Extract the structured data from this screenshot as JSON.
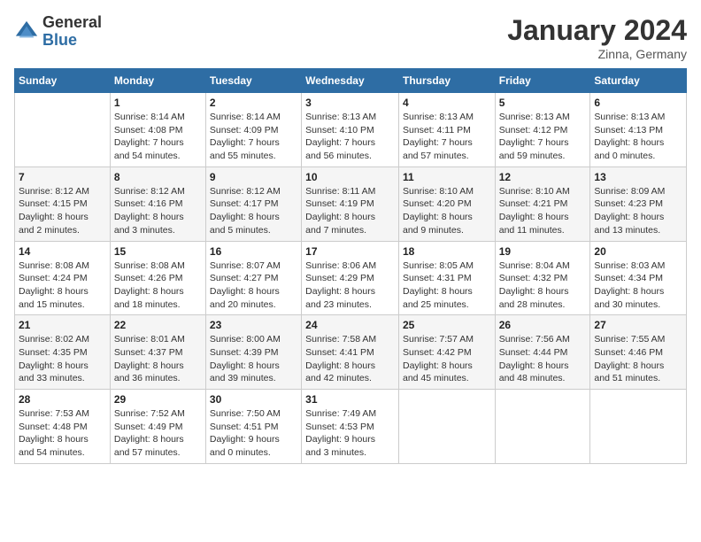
{
  "header": {
    "logo_general": "General",
    "logo_blue": "Blue",
    "month_title": "January 2024",
    "location": "Zinna, Germany"
  },
  "weekdays": [
    "Sunday",
    "Monday",
    "Tuesday",
    "Wednesday",
    "Thursday",
    "Friday",
    "Saturday"
  ],
  "weeks": [
    [
      {
        "day": "",
        "info": ""
      },
      {
        "day": "1",
        "info": "Sunrise: 8:14 AM\nSunset: 4:08 PM\nDaylight: 7 hours\nand 54 minutes."
      },
      {
        "day": "2",
        "info": "Sunrise: 8:14 AM\nSunset: 4:09 PM\nDaylight: 7 hours\nand 55 minutes."
      },
      {
        "day": "3",
        "info": "Sunrise: 8:13 AM\nSunset: 4:10 PM\nDaylight: 7 hours\nand 56 minutes."
      },
      {
        "day": "4",
        "info": "Sunrise: 8:13 AM\nSunset: 4:11 PM\nDaylight: 7 hours\nand 57 minutes."
      },
      {
        "day": "5",
        "info": "Sunrise: 8:13 AM\nSunset: 4:12 PM\nDaylight: 7 hours\nand 59 minutes."
      },
      {
        "day": "6",
        "info": "Sunrise: 8:13 AM\nSunset: 4:13 PM\nDaylight: 8 hours\nand 0 minutes."
      }
    ],
    [
      {
        "day": "7",
        "info": "Sunrise: 8:12 AM\nSunset: 4:15 PM\nDaylight: 8 hours\nand 2 minutes."
      },
      {
        "day": "8",
        "info": "Sunrise: 8:12 AM\nSunset: 4:16 PM\nDaylight: 8 hours\nand 3 minutes."
      },
      {
        "day": "9",
        "info": "Sunrise: 8:12 AM\nSunset: 4:17 PM\nDaylight: 8 hours\nand 5 minutes."
      },
      {
        "day": "10",
        "info": "Sunrise: 8:11 AM\nSunset: 4:19 PM\nDaylight: 8 hours\nand 7 minutes."
      },
      {
        "day": "11",
        "info": "Sunrise: 8:10 AM\nSunset: 4:20 PM\nDaylight: 8 hours\nand 9 minutes."
      },
      {
        "day": "12",
        "info": "Sunrise: 8:10 AM\nSunset: 4:21 PM\nDaylight: 8 hours\nand 11 minutes."
      },
      {
        "day": "13",
        "info": "Sunrise: 8:09 AM\nSunset: 4:23 PM\nDaylight: 8 hours\nand 13 minutes."
      }
    ],
    [
      {
        "day": "14",
        "info": "Sunrise: 8:08 AM\nSunset: 4:24 PM\nDaylight: 8 hours\nand 15 minutes."
      },
      {
        "day": "15",
        "info": "Sunrise: 8:08 AM\nSunset: 4:26 PM\nDaylight: 8 hours\nand 18 minutes."
      },
      {
        "day": "16",
        "info": "Sunrise: 8:07 AM\nSunset: 4:27 PM\nDaylight: 8 hours\nand 20 minutes."
      },
      {
        "day": "17",
        "info": "Sunrise: 8:06 AM\nSunset: 4:29 PM\nDaylight: 8 hours\nand 23 minutes."
      },
      {
        "day": "18",
        "info": "Sunrise: 8:05 AM\nSunset: 4:31 PM\nDaylight: 8 hours\nand 25 minutes."
      },
      {
        "day": "19",
        "info": "Sunrise: 8:04 AM\nSunset: 4:32 PM\nDaylight: 8 hours\nand 28 minutes."
      },
      {
        "day": "20",
        "info": "Sunrise: 8:03 AM\nSunset: 4:34 PM\nDaylight: 8 hours\nand 30 minutes."
      }
    ],
    [
      {
        "day": "21",
        "info": "Sunrise: 8:02 AM\nSunset: 4:35 PM\nDaylight: 8 hours\nand 33 minutes."
      },
      {
        "day": "22",
        "info": "Sunrise: 8:01 AM\nSunset: 4:37 PM\nDaylight: 8 hours\nand 36 minutes."
      },
      {
        "day": "23",
        "info": "Sunrise: 8:00 AM\nSunset: 4:39 PM\nDaylight: 8 hours\nand 39 minutes."
      },
      {
        "day": "24",
        "info": "Sunrise: 7:58 AM\nSunset: 4:41 PM\nDaylight: 8 hours\nand 42 minutes."
      },
      {
        "day": "25",
        "info": "Sunrise: 7:57 AM\nSunset: 4:42 PM\nDaylight: 8 hours\nand 45 minutes."
      },
      {
        "day": "26",
        "info": "Sunrise: 7:56 AM\nSunset: 4:44 PM\nDaylight: 8 hours\nand 48 minutes."
      },
      {
        "day": "27",
        "info": "Sunrise: 7:55 AM\nSunset: 4:46 PM\nDaylight: 8 hours\nand 51 minutes."
      }
    ],
    [
      {
        "day": "28",
        "info": "Sunrise: 7:53 AM\nSunset: 4:48 PM\nDaylight: 8 hours\nand 54 minutes."
      },
      {
        "day": "29",
        "info": "Sunrise: 7:52 AM\nSunset: 4:49 PM\nDaylight: 8 hours\nand 57 minutes."
      },
      {
        "day": "30",
        "info": "Sunrise: 7:50 AM\nSunset: 4:51 PM\nDaylight: 9 hours\nand 0 minutes."
      },
      {
        "day": "31",
        "info": "Sunrise: 7:49 AM\nSunset: 4:53 PM\nDaylight: 9 hours\nand 3 minutes."
      },
      {
        "day": "",
        "info": ""
      },
      {
        "day": "",
        "info": ""
      },
      {
        "day": "",
        "info": ""
      }
    ]
  ]
}
